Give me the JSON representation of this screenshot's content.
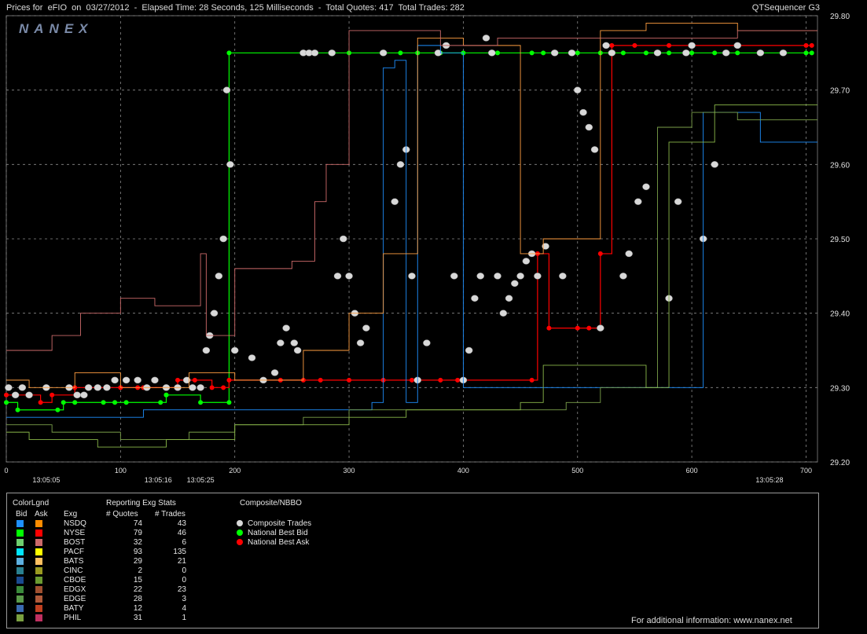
{
  "title": {
    "left": "Prices for  eFIO  on  03/27/2012  -  Elapsed Time: 28 Seconds, 125 Milliseconds  -  Total Quotes: 417  Total Trades: 282",
    "right": "QTSequencer G3"
  },
  "watermark": "NANEX",
  "footer_text": "For additional information: www.nanex.net",
  "colors": {
    "background": "#000000",
    "grid": "#8a8a8a",
    "composite_trade": "#d8d8d8",
    "nbb": "#00ff00",
    "nbo": "#ff0000"
  },
  "chart_data": {
    "type": "line",
    "xlabel": "",
    "ylabel": "",
    "xlim": [
      0,
      710
    ],
    "ylim": [
      29.2,
      29.8
    ],
    "x_ticks": [
      "0",
      "100",
      "200",
      "300",
      "400",
      "500",
      "600",
      "700"
    ],
    "y_ticks": [
      "29.80",
      "29.70",
      "29.60",
      "29.50",
      "29.40",
      "29.30",
      "29.20"
    ],
    "time_labels": [
      {
        "x": 35,
        "label": "13:05:05"
      },
      {
        "x": 133,
        "label": "13:05:16"
      },
      {
        "x": 170,
        "label": "13:05:25"
      },
      {
        "x": 668,
        "label": "13:05:28"
      }
    ],
    "grid": true,
    "series": [
      {
        "name": "National Best Bid",
        "color": "#00ff00",
        "x": [
          0,
          10,
          45,
          50,
          60,
          85,
          95,
          105,
          135,
          140,
          140,
          170,
          195,
          195,
          300,
          330,
          345,
          360,
          380,
          400,
          430,
          460,
          470,
          500,
          520,
          540,
          560,
          580,
          600,
          620,
          640,
          660,
          680,
          700,
          705
        ],
        "y": [
          29.28,
          29.27,
          29.27,
          29.28,
          29.28,
          29.28,
          29.28,
          29.28,
          29.28,
          29.29,
          29.29,
          29.28,
          29.28,
          29.75,
          29.75,
          29.75,
          29.75,
          29.75,
          29.75,
          29.75,
          29.75,
          29.75,
          29.75,
          29.75,
          29.75,
          29.75,
          29.75,
          29.75,
          29.75,
          29.75,
          29.75,
          29.75,
          29.75,
          29.75,
          29.75
        ]
      },
      {
        "name": "National Best Ask",
        "color": "#ff0000",
        "x": [
          0,
          20,
          30,
          40,
          60,
          100,
          115,
          120,
          150,
          165,
          180,
          190,
          195,
          240,
          260,
          275,
          300,
          330,
          355,
          360,
          380,
          395,
          460,
          465,
          475,
          500,
          510,
          520,
          530,
          550,
          580,
          600,
          640,
          700,
          705
        ],
        "y": [
          29.29,
          29.29,
          29.28,
          29.29,
          29.3,
          29.3,
          29.3,
          29.3,
          29.31,
          29.31,
          29.3,
          29.3,
          29.31,
          29.31,
          29.31,
          29.31,
          29.31,
          29.31,
          29.31,
          29.31,
          29.31,
          29.31,
          29.31,
          29.48,
          29.38,
          29.38,
          29.38,
          29.48,
          29.76,
          29.76,
          29.76,
          29.76,
          29.76,
          29.76,
          29.76
        ]
      },
      {
        "name": "Composite Trades",
        "color": "#d8d8d8",
        "x": [
          2,
          8,
          14,
          20,
          35,
          55,
          62,
          68,
          72,
          80,
          88,
          95,
          105,
          115,
          123,
          130,
          140,
          150,
          158,
          163,
          170,
          175,
          178,
          182,
          186,
          190,
          193,
          196,
          200,
          215,
          225,
          235,
          240,
          245,
          252,
          255,
          260,
          265,
          270,
          285,
          290,
          295,
          300,
          305,
          310,
          315,
          330,
          340,
          345,
          350,
          355,
          360,
          368,
          378,
          385,
          392,
          400,
          405,
          410,
          415,
          420,
          425,
          430,
          435,
          440,
          445,
          450,
          455,
          460,
          465,
          472,
          480,
          487,
          495,
          500,
          505,
          510,
          515,
          520,
          525,
          530,
          540,
          545,
          553,
          560,
          570,
          580,
          588,
          595,
          600,
          610,
          620,
          630,
          640,
          660,
          680
        ],
        "y": [
          29.3,
          29.29,
          29.3,
          29.29,
          29.3,
          29.3,
          29.29,
          29.29,
          29.3,
          29.3,
          29.3,
          29.31,
          29.31,
          29.31,
          29.3,
          29.31,
          29.3,
          29.3,
          29.31,
          29.3,
          29.3,
          29.35,
          29.37,
          29.4,
          29.45,
          29.5,
          29.7,
          29.6,
          29.35,
          29.34,
          29.31,
          29.32,
          29.36,
          29.38,
          29.36,
          29.35,
          29.75,
          29.75,
          29.75,
          29.75,
          29.45,
          29.5,
          29.45,
          29.4,
          29.36,
          29.38,
          29.75,
          29.55,
          29.6,
          29.62,
          29.45,
          29.31,
          29.36,
          29.75,
          29.76,
          29.45,
          29.31,
          29.35,
          29.42,
          29.45,
          29.77,
          29.75,
          29.45,
          29.4,
          29.42,
          29.44,
          29.45,
          29.47,
          29.48,
          29.45,
          29.49,
          29.75,
          29.45,
          29.75,
          29.7,
          29.67,
          29.65,
          29.62,
          29.38,
          29.76,
          29.75,
          29.45,
          29.48,
          29.55,
          29.57,
          29.75,
          29.42,
          29.55,
          29.75,
          29.76,
          29.5,
          29.6,
          29.75,
          29.76,
          29.75,
          29.75
        ]
      },
      {
        "name": "NSDQ Bid",
        "color": "#1e90ff",
        "x": [
          0,
          30,
          120,
          200,
          300,
          320,
          330,
          340,
          350,
          360,
          380,
          400,
          420,
          440,
          450,
          480,
          500,
          520,
          540,
          560,
          580,
          600,
          610,
          640,
          660,
          700,
          710
        ],
        "y": [
          29.26,
          29.26,
          29.27,
          29.27,
          29.27,
          29.28,
          29.73,
          29.74,
          29.28,
          29.76,
          29.75,
          29.3,
          29.3,
          29.3,
          29.3,
          29.3,
          29.3,
          29.3,
          29.3,
          29.3,
          29.3,
          29.3,
          29.67,
          29.67,
          29.63,
          29.63,
          29.63
        ]
      },
      {
        "name": "PACF Ask",
        "color": "#ff9e40",
        "x": [
          0,
          20,
          60,
          100,
          160,
          200,
          260,
          300,
          330,
          360,
          400,
          450,
          470,
          520,
          560,
          600,
          640,
          700,
          710
        ],
        "y": [
          29.31,
          29.3,
          29.32,
          29.3,
          29.32,
          29.31,
          29.35,
          29.4,
          29.48,
          29.77,
          29.76,
          29.48,
          29.5,
          29.78,
          29.79,
          29.79,
          29.78,
          29.78,
          29.78
        ]
      },
      {
        "name": "BOST Ask",
        "color": "#cc6a6a",
        "x": [
          0,
          40,
          65,
          100,
          130,
          170,
          175,
          200,
          250,
          270,
          280,
          300,
          330,
          380,
          430,
          460,
          520,
          560,
          600,
          640,
          700,
          710
        ],
        "y": [
          29.35,
          29.37,
          29.4,
          29.42,
          29.41,
          29.48,
          29.37,
          29.46,
          29.47,
          29.55,
          29.6,
          29.78,
          29.78,
          29.76,
          29.77,
          29.77,
          29.77,
          29.77,
          29.77,
          29.78,
          29.78,
          29.78
        ]
      },
      {
        "name": "EDGE Bid",
        "color": "#7ba04a",
        "x": [
          0,
          40,
          100,
          160,
          200,
          260,
          300,
          340,
          380,
          420,
          460,
          490,
          520,
          550,
          570,
          600,
          640,
          700,
          710
        ],
        "y": [
          29.25,
          29.24,
          29.23,
          29.24,
          29.25,
          29.26,
          29.27,
          29.27,
          29.27,
          29.27,
          29.27,
          29.28,
          29.3,
          29.3,
          29.65,
          29.67,
          29.66,
          29.66,
          29.66
        ]
      },
      {
        "name": "PHIL Bid",
        "color": "#8ab84a",
        "x": [
          0,
          20,
          80,
          140,
          200,
          300,
          350,
          400,
          450,
          470,
          520,
          560,
          580,
          620,
          660,
          710
        ],
        "y": [
          29.24,
          29.23,
          29.22,
          29.23,
          29.25,
          29.26,
          29.27,
          29.27,
          29.28,
          29.33,
          29.33,
          29.3,
          29.63,
          29.68,
          29.68,
          29.68
        ]
      }
    ],
    "legend": {
      "panel_title": "ColorLgnd",
      "stats_title": "Reporting Exg Stats",
      "composite_title": "Composite/NBBO",
      "headers": {
        "bid": "Bid",
        "ask": "Ask",
        "exg": "Exg",
        "quotes": "# Quotes",
        "trades": "# Trades"
      },
      "rows": [
        {
          "exg": "NSDQ",
          "bid_color": "#1e90ff",
          "ask_color": "#ff8c00",
          "quotes": "74",
          "trades": "43"
        },
        {
          "exg": "NYSE",
          "bid_color": "#00ff00",
          "ask_color": "#ff0000",
          "quotes": "79",
          "trades": "46"
        },
        {
          "exg": "BOST",
          "bid_color": "#6fcf6f",
          "ask_color": "#cc6a6a",
          "quotes": "32",
          "trades": "6"
        },
        {
          "exg": "PACF",
          "bid_color": "#00e5ff",
          "ask_color": "#ffff00",
          "quotes": "93",
          "trades": "135"
        },
        {
          "exg": "BATS",
          "bid_color": "#5db0e0",
          "ask_color": "#ffc060",
          "quotes": "29",
          "trades": "21"
        },
        {
          "exg": "CINC",
          "bid_color": "#2a8090",
          "ask_color": "#9a9a20",
          "quotes": "2",
          "trades": "0"
        },
        {
          "exg": "CBOE",
          "bid_color": "#1a4a90",
          "ask_color": "#6a9a30",
          "quotes": "15",
          "trades": "0"
        },
        {
          "exg": "EDGX",
          "bid_color": "#3a8a3a",
          "ask_color": "#a05030",
          "quotes": "22",
          "trades": "23"
        },
        {
          "exg": "EDGE",
          "bid_color": "#5a9a4a",
          "ask_color": "#b05a3a",
          "quotes": "28",
          "trades": "3"
        },
        {
          "exg": "BATY",
          "bid_color": "#3a6ab0",
          "ask_color": "#c04020",
          "quotes": "12",
          "trades": "4"
        },
        {
          "exg": "PHIL",
          "bid_color": "#7aa040",
          "ask_color": "#c03060",
          "quotes": "31",
          "trades": "1"
        }
      ],
      "composite_items": [
        {
          "label": "Composite Trades",
          "color": "#d8d8d8"
        },
        {
          "label": "National Best Bid",
          "color": "#00ff00"
        },
        {
          "label": "National Best Ask",
          "color": "#ff0000"
        }
      ]
    }
  }
}
